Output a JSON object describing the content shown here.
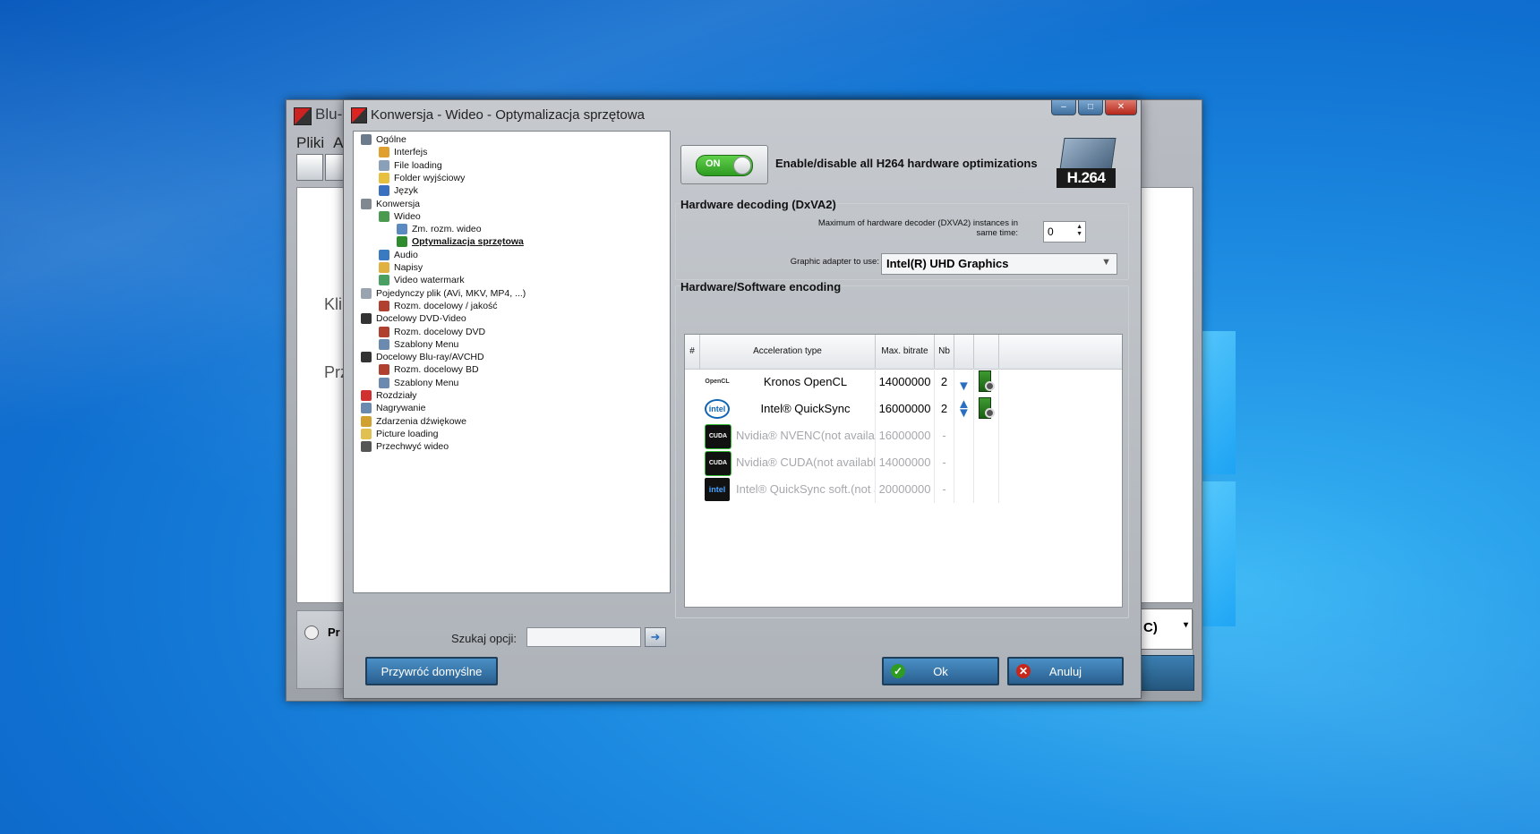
{
  "back_window": {
    "title": "Blu-",
    "menu": [
      "Pliki",
      "Ac"
    ],
    "content_text_1": "Klil",
    "content_text_2": "Prz",
    "bottom_label": "Pr",
    "combo_text": "C)"
  },
  "dialog": {
    "title": "Konwersja - Wideo - Optymalizacja sprzętowa"
  },
  "tree": [
    {
      "label": "Ogólne",
      "indent": 0,
      "color": "#6b7b8c"
    },
    {
      "label": "Interfejs",
      "indent": 1,
      "color": "#e0a030"
    },
    {
      "label": "File loading",
      "indent": 1,
      "color": "#8aa0b8"
    },
    {
      "label": "Folder wyjściowy",
      "indent": 1,
      "color": "#e8c040"
    },
    {
      "label": "Język",
      "indent": 1,
      "color": "#3a70c0"
    },
    {
      "label": "Konwersja",
      "indent": 0,
      "color": "#808890"
    },
    {
      "label": "Wideo",
      "indent": 1,
      "color": "#4a9a50"
    },
    {
      "label": "Zm. rozm. wideo",
      "indent": 2,
      "color": "#5a8ac0"
    },
    {
      "label": "Optymalizacja sprzętowa",
      "indent": 2,
      "color": "#2e8b2e",
      "selected": true
    },
    {
      "label": "Audio",
      "indent": 1,
      "color": "#3a7ac0"
    },
    {
      "label": "Napisy",
      "indent": 1,
      "color": "#e0b040"
    },
    {
      "label": "Video watermark",
      "indent": 1,
      "color": "#4aa060"
    },
    {
      "label": "Pojedynczy plik (AVi, MKV, MP4, ...)",
      "indent": 0,
      "color": "#9aa4b0"
    },
    {
      "label": "Rozm. docelowy / jakość",
      "indent": 1,
      "color": "#b04030"
    },
    {
      "label": "Docelowy DVD-Video",
      "indent": 0,
      "color": "#333333"
    },
    {
      "label": "Rozm. docelowy DVD",
      "indent": 1,
      "color": "#b04030"
    },
    {
      "label": "Szablony Menu",
      "indent": 1,
      "color": "#6a8ab0"
    },
    {
      "label": "Docelowy Blu-ray/AVCHD",
      "indent": 0,
      "color": "#333333"
    },
    {
      "label": "Rozm. docelowy BD",
      "indent": 1,
      "color": "#b04030"
    },
    {
      "label": "Szablony Menu",
      "indent": 1,
      "color": "#6a8ab0"
    },
    {
      "label": "Rozdziały",
      "indent": 0,
      "color": "#d03030"
    },
    {
      "label": "Nagrywanie",
      "indent": 0,
      "color": "#6a8ab0"
    },
    {
      "label": "Zdarzenia dźwiękowe",
      "indent": 0,
      "color": "#d0a030"
    },
    {
      "label": "Picture loading",
      "indent": 0,
      "color": "#e0c050"
    },
    {
      "label": "Przechwyć wideo",
      "indent": 0,
      "color": "#555555"
    }
  ],
  "search": {
    "label": "Szukaj opcji:",
    "value": ""
  },
  "buttons": {
    "restore_defaults": "Przywróć domyślne",
    "ok": "Ok",
    "cancel": "Anuluj"
  },
  "h264": {
    "toggle_label": "ON",
    "toggle_on": true,
    "enable_text": "Enable/disable all H264 hardware optimizations",
    "badge_text": "H.264"
  },
  "decoding": {
    "title": "Hardware decoding (DxVA2)",
    "max_instances_label": "Maximum of hardware decoder (DXVA2) instances in same time:",
    "max_instances_value": "0",
    "adapter_label": "Graphic adapter to use:",
    "adapter_value": "Intel(R) UHD Graphics"
  },
  "encoding": {
    "title": "Hardware/Software encoding",
    "columns": [
      "#",
      "Acceleration type",
      "Max. bitrate",
      "Nb",
      "",
      ""
    ],
    "rows": [
      {
        "logo": "ocl",
        "logo_text": "OpenCL",
        "type": "Kronos OpenCL",
        "bitrate": "14000000",
        "nb": "2",
        "available": true,
        "arrows": "down"
      },
      {
        "logo": "intel",
        "logo_text": "intel",
        "type": "Intel® QuickSync",
        "bitrate": "16000000",
        "nb": "2",
        "available": true,
        "arrows": "updown"
      },
      {
        "logo": "cuda",
        "logo_text": "CUDA",
        "type": "Nvidia® NVENC(not available)",
        "bitrate": "16000000",
        "nb": "-",
        "available": false
      },
      {
        "logo": "cuda",
        "logo_text": "CUDA",
        "type": "Nvidia® CUDA(not available)",
        "bitrate": "14000000",
        "nb": "-",
        "available": false
      },
      {
        "logo": "intel-dark",
        "logo_text": "intel",
        "type": "Intel® QuickSync soft.(not a...",
        "bitrate": "20000000",
        "nb": "-",
        "available": false
      }
    ]
  }
}
